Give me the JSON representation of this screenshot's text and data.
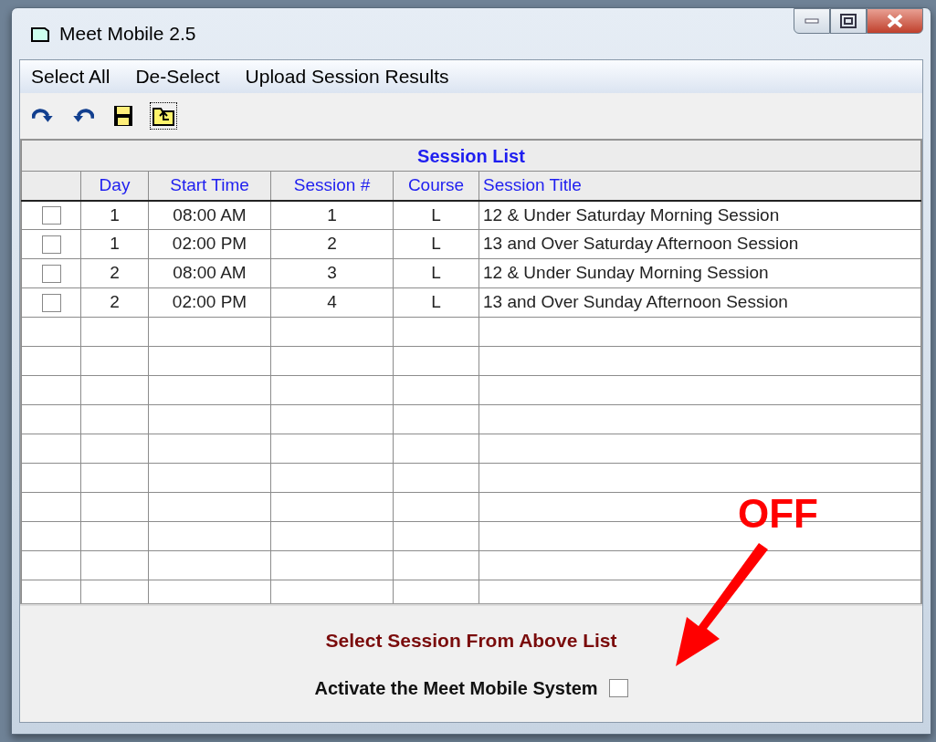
{
  "window": {
    "title": "Meet Mobile 2.5"
  },
  "menu": [
    "Select All",
    "De-Select",
    "Upload Session Results"
  ],
  "toolbar": [
    {
      "kind": "redo",
      "selected": false
    },
    {
      "kind": "undo",
      "selected": false
    },
    {
      "kind": "save",
      "selected": false
    },
    {
      "kind": "upload",
      "selected": true
    }
  ],
  "table": {
    "title": "Session List",
    "columns": [
      "Day",
      "Start Time",
      "Session #",
      "Course",
      "Session Title"
    ],
    "rows": [
      {
        "checked": false,
        "cells": [
          "1",
          "08:00 AM",
          "1",
          "L",
          "12 & Under Saturday Morning Session"
        ]
      },
      {
        "checked": false,
        "cells": [
          "1",
          "02:00 PM",
          "2",
          "L",
          "13 and Over Saturday Afternoon Session"
        ]
      },
      {
        "checked": false,
        "cells": [
          "2",
          "08:00 AM",
          "3",
          "L",
          "12 & Under Sunday Morning Session"
        ]
      },
      {
        "checked": false,
        "cells": [
          "2",
          "02:00 PM",
          "4",
          "L",
          "13 and Over Sunday Afternoon Session"
        ]
      }
    ]
  },
  "instruction": "Select Session From Above List",
  "activate": {
    "label": "Activate the Meet Mobile System",
    "checked": false
  },
  "annotation": {
    "label": "OFF"
  }
}
